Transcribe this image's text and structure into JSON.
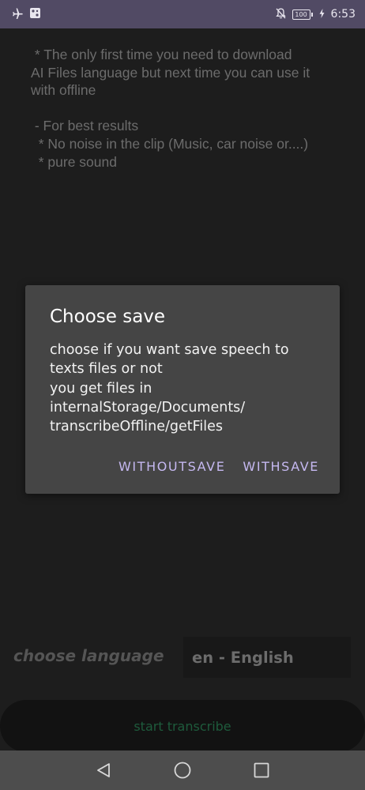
{
  "status_bar": {
    "icons": [
      "airplane-mode-icon",
      "app-notification-icon",
      "bell-off-icon",
      "battery-icon",
      "charging-icon"
    ],
    "battery_level": "100",
    "time": "6:53"
  },
  "info": {
    "text": " * The only first time you need to download\nAI Files language but next time you can use it\nwith offline\n\n - For best results\n  * No noise in the clip (Music, car noise or....)\n  * pure sound"
  },
  "dialog": {
    "title": "Choose save",
    "message": "choose if you want save speech to\ntexts files or not\nyou get files in\ninternalStorage/Documents/\ntranscribeOffline/getFiles",
    "buttons": {
      "without_save": "WITHOUTSAVE",
      "with_save": "WITHSAVE"
    }
  },
  "language": {
    "label": "choose language",
    "selected": "en - English"
  },
  "start_button": {
    "label": "start transcribe"
  },
  "nav_bar": {
    "icons": [
      "back-icon",
      "home-icon",
      "recents-icon"
    ]
  },
  "colors": {
    "status_bar": "#514a64",
    "background": "#1d1d1d",
    "dialog": "#454545",
    "dialog_button": "#c5b8f0",
    "start_text": "#1e5b3c"
  }
}
